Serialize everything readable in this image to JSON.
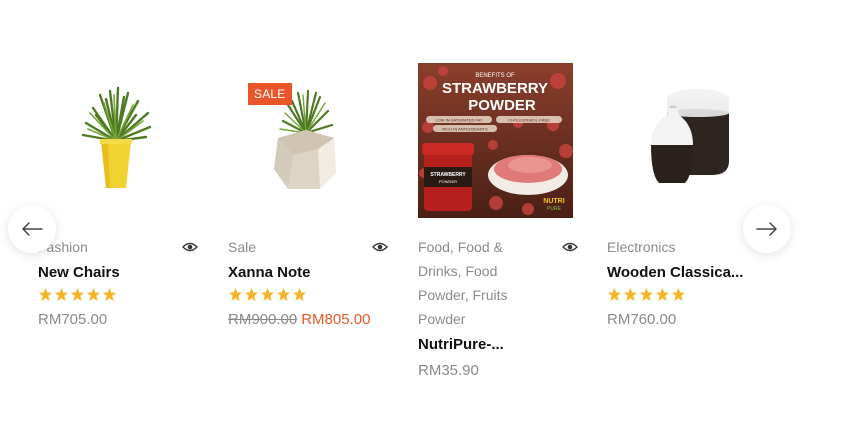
{
  "products": [
    {
      "category": "Fashion",
      "title": "New Chairs",
      "rating": 5,
      "price": "RM705.00",
      "old_price": "",
      "image": "yellow-pot-plant-image"
    },
    {
      "badge": "SALE",
      "category": "Sale",
      "title": "Xanna Note",
      "rating": 5,
      "old_price": "RM900.00",
      "price": "RM805.00",
      "image": "stone-pot-plant-image"
    },
    {
      "category_lines": [
        "Food, Food &",
        "Drinks, Food",
        "Powder, Fruits",
        "Powder"
      ],
      "title": "NutriPure-...",
      "price": "RM35.90",
      "image": "strawberry-powder-image",
      "image_text": {
        "heading_small": "BENEFITS OF",
        "heading_1": "STRAWBERRY",
        "heading_2": "POWDER",
        "tag_1": "LOW IN SATURATED FAT",
        "tag_2": "CHOLESTEROL-FREE",
        "tag_3": "RICH IN ANTIOXIDANTS",
        "jar_label_1": "STRAWBERRY",
        "jar_label_2": "POWDER",
        "brand_1": "NUTRI",
        "brand_2": "PURE"
      }
    },
    {
      "category": "Electronics",
      "title": "Wooden Classica...",
      "rating": 5,
      "price": "RM760.00",
      "image": "vase-set-image"
    }
  ],
  "colors": {
    "accent": "#e8562a",
    "star": "#f5b325",
    "muted": "#8a8a8a"
  },
  "icons": {
    "prev": "arrow-left-icon",
    "next": "arrow-right-icon",
    "quick_view": "eye-icon",
    "rating": "star-icon"
  }
}
